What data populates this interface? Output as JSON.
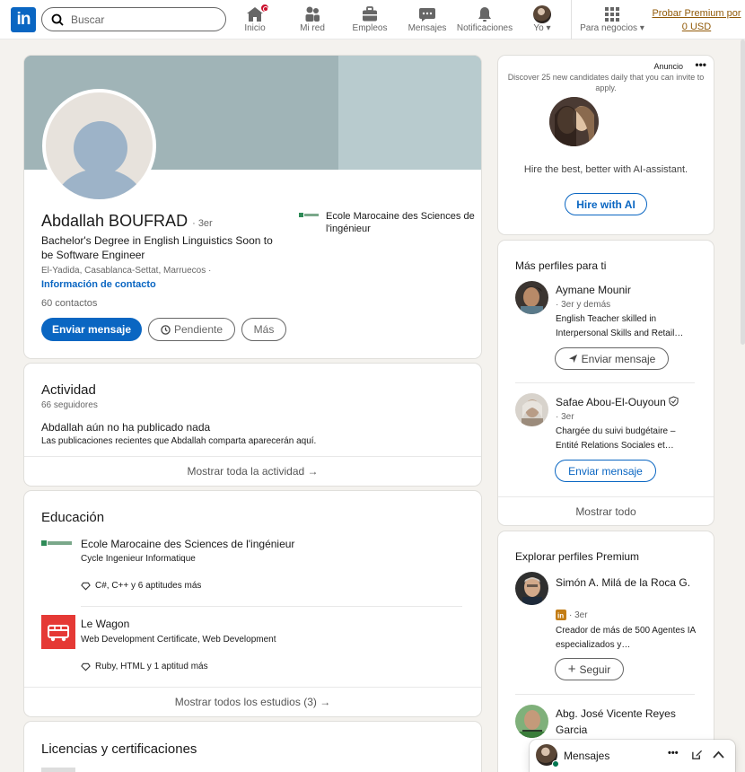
{
  "nav": {
    "logo": "in",
    "search_placeholder": "Buscar",
    "items": [
      {
        "label": "Inicio",
        "icon": "home-icon"
      },
      {
        "label": "Mi red",
        "icon": "network-icon"
      },
      {
        "label": "Empleos",
        "icon": "briefcase-icon"
      },
      {
        "label": "Mensajes",
        "icon": "messaging-icon"
      },
      {
        "label": "Notificaciones",
        "icon": "bell-icon"
      },
      {
        "label": "Yo",
        "icon": "avatar-icon"
      },
      {
        "label": "Para negocios",
        "icon": "grid-icon"
      }
    ],
    "premium": "Probar Premium por 0 USD"
  },
  "profile": {
    "name": "Abdallah BOUFRAD",
    "degree": "· 3er",
    "headline": "Bachelor's Degree in English Linguistics Soon to be Software Engineer",
    "location": "El-Yadida, Casablanca-Settat, Marruecos ·",
    "contact_info": "Información de contacto",
    "contacts": "60 contactos",
    "school": "Ecole Marocaine des Sciences de l'ingénieur",
    "buttons": {
      "message": "Enviar mensaje",
      "pending": "Pendiente",
      "more": "Más"
    }
  },
  "activity": {
    "title": "Actividad",
    "followers": "66 seguidores",
    "empty_title": "Abdallah aún no ha publicado nada",
    "empty_desc": "Las publicaciones recientes que Abdallah comparta aparecerán aquí.",
    "show_all": "Mostrar toda la actividad →"
  },
  "education": {
    "title": "Educación",
    "items": [
      {
        "school": "Ecole Marocaine des Sciences de l'ingénieur",
        "degree": "Cycle Ingenieur Informatique",
        "skills": "C#, C++ y 6 aptitudes más"
      },
      {
        "school": "Le Wagon",
        "degree": "Web Development Certificate, Web Development",
        "skills": "Ruby, HTML y 1 aptitud más"
      }
    ],
    "show_all": "Mostrar todos los estudios (3) →"
  },
  "licenses": {
    "title": "Licencias y certificaciones"
  },
  "ad": {
    "label": "Anuncio",
    "tagline": "Discover 25 new candidates daily that you can invite to apply.",
    "text": "Hire the best, better with AI-assistant.",
    "cta": "Hire with AI"
  },
  "more_profiles": {
    "title": "Más perfiles para ti",
    "people": [
      {
        "name": "Aymane Mounir",
        "meta": "· 3er y demás",
        "desc": "English Teacher skilled in Interpersonal Skills and Retail…",
        "button": "Enviar mensaje"
      },
      {
        "name": "Safae Abou-El-Ouyoun",
        "meta": "· 3er",
        "desc": "Chargée du suivi budgétaire – Entité Relations Sociales et…",
        "button": "Enviar mensaje"
      }
    ],
    "show_all": "Mostrar todo"
  },
  "premium_profiles": {
    "title": "Explorar perfiles Premium",
    "people": [
      {
        "name": "Simón A. Milá de la Roca G.",
        "meta": "· 3er",
        "desc": "Creador de más de 500 Agentes IA especializados y…",
        "button": "Seguir"
      },
      {
        "name": "Abg. José Vicente Reyes Garcia"
      }
    ]
  },
  "messaging": {
    "label": "Mensajes"
  }
}
